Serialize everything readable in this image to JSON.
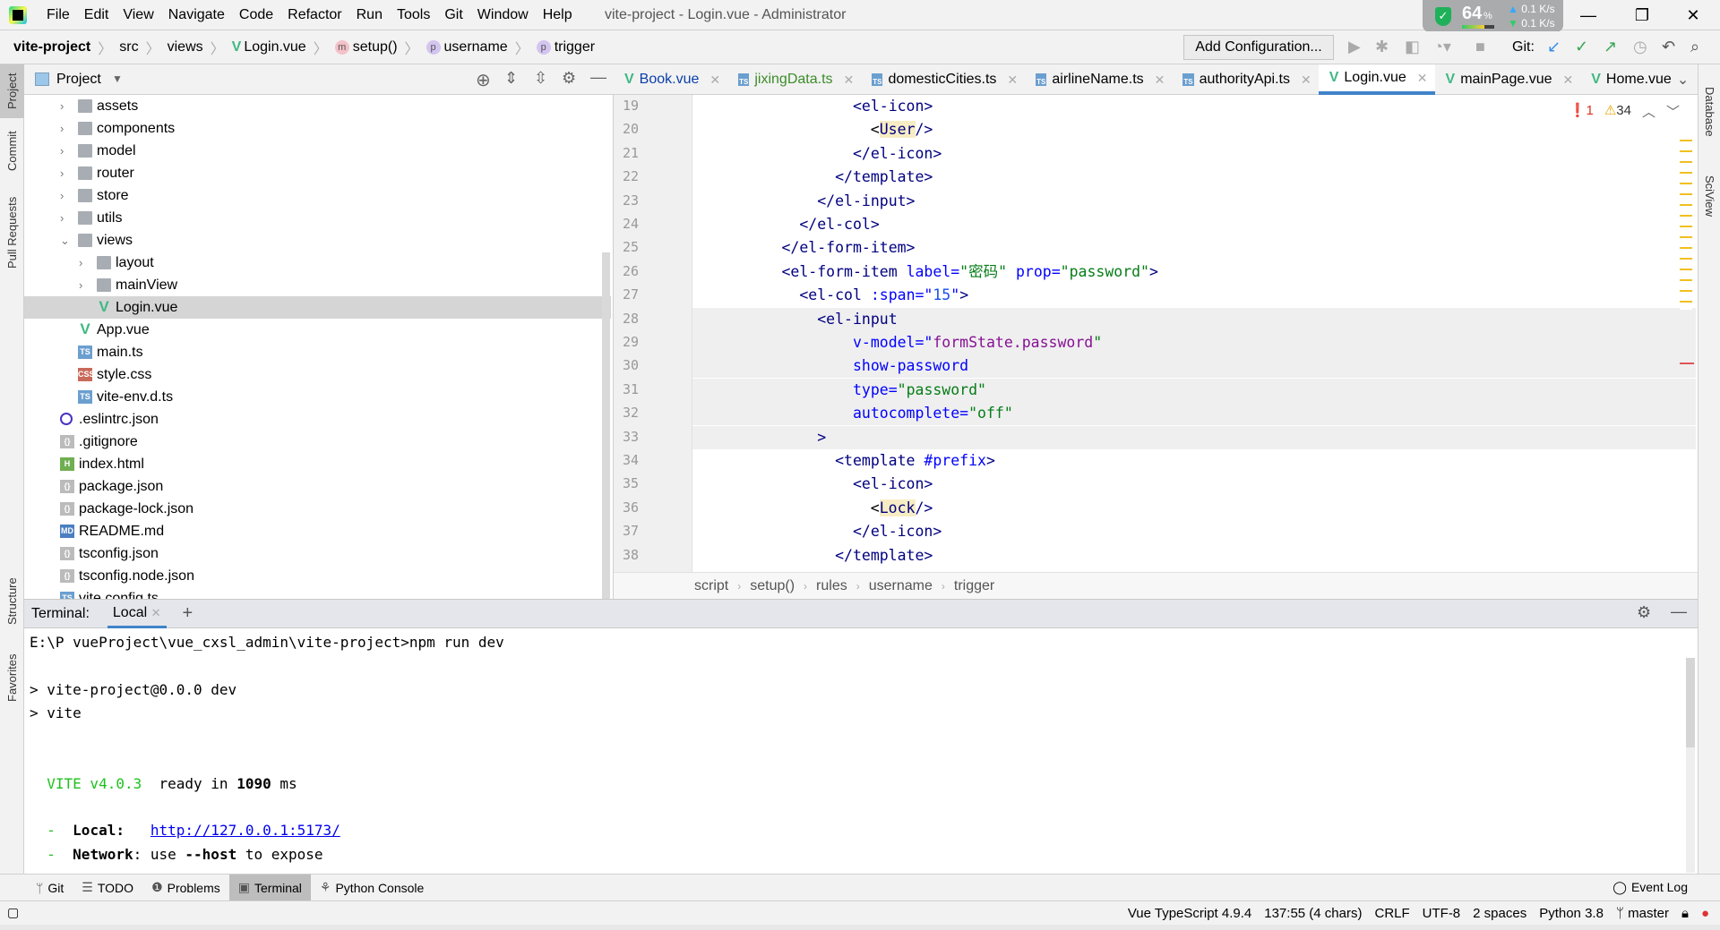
{
  "window": {
    "title": "vite-project - Login.vue - Administrator",
    "menu": [
      "File",
      "Edit",
      "View",
      "Navigate",
      "Code",
      "Refactor",
      "Run",
      "Tools",
      "Git",
      "Window",
      "Help"
    ],
    "net_widget": {
      "cpu_percent": "64",
      "cpu_unit": "%",
      "up": "0.1",
      "down": "0.1",
      "unit": "K/s"
    }
  },
  "navbar": {
    "crumbs": [
      {
        "label": "vite-project",
        "icon": ""
      },
      {
        "label": "src",
        "icon": ""
      },
      {
        "label": "views",
        "icon": ""
      },
      {
        "label": "Login.vue",
        "icon": "vue-icon"
      },
      {
        "label": "setup()",
        "icon": "m"
      },
      {
        "label": "username",
        "icon": "p"
      },
      {
        "label": "trigger",
        "icon": "p"
      }
    ],
    "add_configuration": "Add Configuration...",
    "git_label": "Git:"
  },
  "left_strip": [
    "Project",
    "Commit",
    "Pull Requests",
    "Structure",
    "Favorites"
  ],
  "right_strip": [
    "Database",
    "SciView"
  ],
  "project": {
    "title": "Project",
    "tree": [
      {
        "label": "assets",
        "type": "folder",
        "level": 1,
        "chevron": "right"
      },
      {
        "label": "components",
        "type": "folder",
        "level": 1,
        "chevron": "right"
      },
      {
        "label": "model",
        "type": "folder",
        "level": 1,
        "chevron": "right"
      },
      {
        "label": "router",
        "type": "folder",
        "level": 1,
        "chevron": "right"
      },
      {
        "label": "store",
        "type": "folder",
        "level": 1,
        "chevron": "right"
      },
      {
        "label": "utils",
        "type": "folder",
        "level": 1,
        "chevron": "right"
      },
      {
        "label": "views",
        "type": "folder",
        "level": 1,
        "chevron": "down"
      },
      {
        "label": "layout",
        "type": "folder",
        "level": 2,
        "chevron": "right"
      },
      {
        "label": "mainView",
        "type": "folder",
        "level": 2,
        "chevron": "right"
      },
      {
        "label": "Login.vue",
        "type": "vue",
        "level": 2,
        "chevron": "",
        "selected": true
      },
      {
        "label": "App.vue",
        "type": "vue",
        "level": 1,
        "chevron": ""
      },
      {
        "label": "main.ts",
        "type": "ts",
        "level": 1,
        "chevron": ""
      },
      {
        "label": "style.css",
        "type": "css",
        "level": 1,
        "chevron": ""
      },
      {
        "label": "vite-env.d.ts",
        "type": "ts",
        "level": 1,
        "chevron": ""
      },
      {
        "label": ".eslintrc.json",
        "type": "eslint",
        "level": 0,
        "chevron": ""
      },
      {
        "label": ".gitignore",
        "type": "json",
        "level": 0,
        "chevron": ""
      },
      {
        "label": "index.html",
        "type": "html",
        "level": 0,
        "chevron": ""
      },
      {
        "label": "package.json",
        "type": "json",
        "level": 0,
        "chevron": ""
      },
      {
        "label": "package-lock.json",
        "type": "json",
        "level": 0,
        "chevron": ""
      },
      {
        "label": "README.md",
        "type": "md",
        "level": 0,
        "chevron": ""
      },
      {
        "label": "tsconfig.json",
        "type": "json",
        "level": 0,
        "chevron": ""
      },
      {
        "label": "tsconfig.node.json",
        "type": "json",
        "level": 0,
        "chevron": ""
      },
      {
        "label": "vite.config.ts",
        "type": "ts",
        "level": 0,
        "chevron": ""
      }
    ]
  },
  "editor": {
    "tabs": [
      {
        "label": "Book.vue",
        "type": "vue",
        "color": "#0b3fa8"
      },
      {
        "label": "jixingData.ts",
        "type": "ts",
        "color": "#3c8c2a"
      },
      {
        "label": "domesticCities.ts",
        "type": "ts",
        "color": "#000000"
      },
      {
        "label": "airlineName.ts",
        "type": "ts",
        "color": "#000000"
      },
      {
        "label": "authorityApi.ts",
        "type": "ts",
        "color": "#000000"
      },
      {
        "label": "Login.vue",
        "type": "vue",
        "color": "#000000",
        "active": true
      },
      {
        "label": "mainPage.vue",
        "type": "vue",
        "color": "#000000"
      },
      {
        "label": "Home.vue",
        "type": "vue",
        "color": "#000000"
      }
    ],
    "errors": "1",
    "warnings": "34",
    "lines": [
      {
        "n": "19",
        "segs": [
          [
            "                ",
            ""
          ],
          [
            "<el-icon>",
            "tag"
          ]
        ]
      },
      {
        "n": "20",
        "segs": [
          [
            "                  <",
            ""
          ],
          [
            "User",
            "comp"
          ],
          [
            "/>",
            "tag"
          ]
        ]
      },
      {
        "n": "21",
        "segs": [
          [
            "                ",
            ""
          ],
          [
            "</el-icon>",
            "tag"
          ]
        ]
      },
      {
        "n": "22",
        "segs": [
          [
            "              ",
            ""
          ],
          [
            "</template>",
            "tag"
          ]
        ]
      },
      {
        "n": "23",
        "segs": [
          [
            "            ",
            ""
          ],
          [
            "</el-input>",
            "tag"
          ]
        ]
      },
      {
        "n": "24",
        "segs": [
          [
            "          ",
            ""
          ],
          [
            "</el-col>",
            "tag"
          ]
        ]
      },
      {
        "n": "25",
        "segs": [
          [
            "        ",
            ""
          ],
          [
            "</el-form-item>",
            "tag"
          ]
        ]
      },
      {
        "n": "26",
        "segs": [
          [
            "        ",
            ""
          ],
          [
            "<el-form-item ",
            "tag"
          ],
          [
            "label",
            "attr"
          ],
          [
            "=",
            "attr"
          ],
          [
            "\"密码\"",
            "str"
          ],
          [
            " prop",
            "attr"
          ],
          [
            "=",
            "attr"
          ],
          [
            "\"password\"",
            "str"
          ],
          [
            ">",
            "tag"
          ]
        ]
      },
      {
        "n": "27",
        "segs": [
          [
            "          ",
            ""
          ],
          [
            "<el-col ",
            "tag"
          ],
          [
            ":span",
            "attr"
          ],
          [
            "=\"",
            "attr"
          ],
          [
            "15",
            "num"
          ],
          [
            "\"",
            "attr"
          ],
          [
            ">",
            "tag"
          ]
        ]
      },
      {
        "n": "28",
        "segs": [
          [
            "            ",
            ""
          ],
          [
            "<el-input",
            "tag"
          ]
        ],
        "hl": true
      },
      {
        "n": "29",
        "segs": [
          [
            "                ",
            ""
          ],
          [
            "v-model",
            "attr"
          ],
          [
            "=\"",
            "attr"
          ],
          [
            "formState.password",
            "expr"
          ],
          [
            "\"",
            "str"
          ]
        ],
        "hl": true
      },
      {
        "n": "30",
        "segs": [
          [
            "                ",
            ""
          ],
          [
            "show-password",
            "attr"
          ]
        ],
        "hl": true
      },
      {
        "n": "31",
        "segs": [
          [
            "                ",
            ""
          ],
          [
            "type",
            "attr"
          ],
          [
            "=",
            "attr"
          ],
          [
            "\"password\"",
            "str"
          ]
        ],
        "hl": true
      },
      {
        "n": "32",
        "segs": [
          [
            "                ",
            ""
          ],
          [
            "autocomplete",
            "attr"
          ],
          [
            "=",
            "attr"
          ],
          [
            "\"off\"",
            "str"
          ]
        ],
        "hl": true
      },
      {
        "n": "33",
        "segs": [
          [
            "            ",
            ""
          ],
          [
            ">",
            "tag"
          ]
        ],
        "hl": true
      },
      {
        "n": "34",
        "segs": [
          [
            "              ",
            ""
          ],
          [
            "<template ",
            "tag"
          ],
          [
            "#prefix",
            "attr"
          ],
          [
            ">",
            "tag"
          ]
        ]
      },
      {
        "n": "35",
        "segs": [
          [
            "                ",
            ""
          ],
          [
            "<el-icon>",
            "tag"
          ]
        ]
      },
      {
        "n": "36",
        "segs": [
          [
            "                  <",
            ""
          ],
          [
            "Lock",
            "comp"
          ],
          [
            "/>",
            "tag"
          ]
        ]
      },
      {
        "n": "37",
        "segs": [
          [
            "                ",
            ""
          ],
          [
            "</el-icon>",
            "tag"
          ]
        ]
      },
      {
        "n": "38",
        "segs": [
          [
            "              ",
            ""
          ],
          [
            "</template>",
            "tag"
          ]
        ]
      }
    ],
    "breadcrumbs": [
      "script",
      "setup()",
      "rules",
      "username",
      "trigger"
    ]
  },
  "terminal": {
    "label": "Terminal:",
    "tab": "Local",
    "lines": [
      [
        [
          "E:\\P vueProject\\vue_cxsl_admin\\vite-project>npm run dev",
          ""
        ]
      ],
      [],
      [
        [
          "> vite-project@0.0.0 dev",
          ""
        ]
      ],
      [
        [
          "> vite",
          ""
        ]
      ],
      [],
      [],
      [
        [
          "  ",
          ""
        ],
        [
          "VITE v4.0.3",
          "g"
        ],
        [
          "  ready in ",
          ""
        ],
        [
          "1090",
          "b"
        ],
        [
          " ms",
          ""
        ]
      ],
      [],
      [
        [
          "  ",
          ""
        ],
        [
          "-",
          "g"
        ],
        [
          "  ",
          ""
        ],
        [
          "Local:",
          "b"
        ],
        [
          "   ",
          ""
        ],
        [
          "http://127.0.0.1:5173/",
          "lnk"
        ]
      ],
      [
        [
          "  ",
          ""
        ],
        [
          "-",
          "g"
        ],
        [
          "  ",
          ""
        ],
        [
          "Network",
          "b"
        ],
        [
          ": use ",
          ""
        ],
        [
          "--host",
          "b"
        ],
        [
          " to expose",
          ""
        ]
      ]
    ]
  },
  "bottom_tools": [
    {
      "label": "Git",
      "icon": "git-icon"
    },
    {
      "label": "TODO",
      "icon": "todo-icon"
    },
    {
      "label": "Problems",
      "icon": "problems-icon"
    },
    {
      "label": "Terminal",
      "icon": "terminal-icon",
      "active": true
    },
    {
      "label": "Python Console",
      "icon": "python-icon"
    }
  ],
  "event_log": "Event Log",
  "status": {
    "language": "Vue TypeScript 4.9.4",
    "position": "137:55 (4 chars)",
    "line_sep": "CRLF",
    "encoding": "UTF-8",
    "indent": "2 spaces",
    "interpreter": "Python 3.8",
    "branch": "master"
  }
}
